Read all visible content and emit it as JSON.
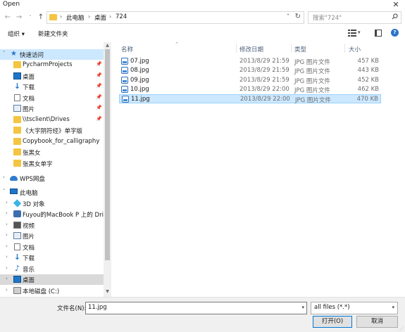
{
  "window": {
    "title": "Open",
    "close": "✕"
  },
  "address": {
    "path": [
      "此电脑",
      "桌面",
      "724"
    ],
    "separator": "›"
  },
  "search": {
    "placeholder": "搜索\"724\""
  },
  "toolbar": {
    "organize": "组织 ▾",
    "new_folder": "新建文件夹"
  },
  "nav": {
    "items": [
      {
        "label": "快速访问",
        "icon": "star-icon",
        "chev": "˅"
      },
      {
        "label": "PycharmProjects",
        "icon": "folder-icon",
        "pin": true
      },
      {
        "label": "桌面",
        "icon": "desktop-icon",
        "pin": true
      },
      {
        "label": "下载",
        "icon": "download-icon",
        "pin": true
      },
      {
        "label": "文档",
        "icon": "document-icon",
        "pin": true
      },
      {
        "label": "图片",
        "icon": "picture-icon",
        "pin": true
      },
      {
        "label": "\\\\tsclient\\Drives",
        "icon": "network-folder-icon",
        "pin": true
      },
      {
        "label": "《大字阴符经》单字版",
        "icon": "folder-icon"
      },
      {
        "label": "Copybook_for_calligraphy",
        "icon": "folder-icon"
      },
      {
        "label": "张黑女",
        "icon": "folder-icon"
      },
      {
        "label": "张黑女单字",
        "icon": "folder-icon"
      },
      {
        "label": "WPS网盘",
        "icon": "cloud-icon",
        "chev": "›"
      },
      {
        "label": "此电脑",
        "icon": "computer-icon",
        "chev": "˅"
      },
      {
        "label": "3D 对象",
        "icon": "3d-objects-icon",
        "chev": "›"
      },
      {
        "label": "Fuyou的MacBook P 上的 Drive",
        "icon": "network-drive-icon",
        "chev": "›"
      },
      {
        "label": "视频",
        "icon": "video-icon",
        "chev": "›"
      },
      {
        "label": "图片",
        "icon": "picture-icon",
        "chev": "›"
      },
      {
        "label": "文档",
        "icon": "document-icon",
        "chev": "›"
      },
      {
        "label": "下载",
        "icon": "download-icon",
        "chev": "›"
      },
      {
        "label": "音乐",
        "icon": "music-icon",
        "chev": "›"
      },
      {
        "label": "桌面",
        "icon": "desktop-icon",
        "chev": "›"
      },
      {
        "label": "本地磁盘 (C:)",
        "icon": "drive-icon",
        "chev": "›"
      }
    ],
    "pin_glyph": "📌"
  },
  "columns": {
    "name": "名称",
    "date": "修改日期",
    "type": "类型",
    "size": "大小"
  },
  "files": [
    {
      "name": "07.jpg",
      "date": "2013/8/29 21:59",
      "type": "JPG 图片文件",
      "size": "457 KB"
    },
    {
      "name": "08.jpg",
      "date": "2013/8/29 21:59",
      "type": "JPG 图片文件",
      "size": "443 KB"
    },
    {
      "name": "09.jpg",
      "date": "2013/8/29 21:59",
      "type": "JPG 图片文件",
      "size": "452 KB"
    },
    {
      "name": "10.jpg",
      "date": "2013/8/29 22:00",
      "type": "JPG 图片文件",
      "size": "462 KB"
    },
    {
      "name": "11.jpg",
      "date": "2013/8/29 22:00",
      "type": "JPG 图片文件",
      "size": "470 KB",
      "selected": true
    }
  ],
  "bottom": {
    "filename_label": "文件名(N):",
    "filename_value": "11.jpg",
    "filter_value": "all files (*.*)",
    "open_label": "打开(O)",
    "cancel_label": "取消"
  },
  "colors": {
    "selection": "#cce8ff",
    "accent": "#0078d7",
    "folder": "#f4c542"
  }
}
